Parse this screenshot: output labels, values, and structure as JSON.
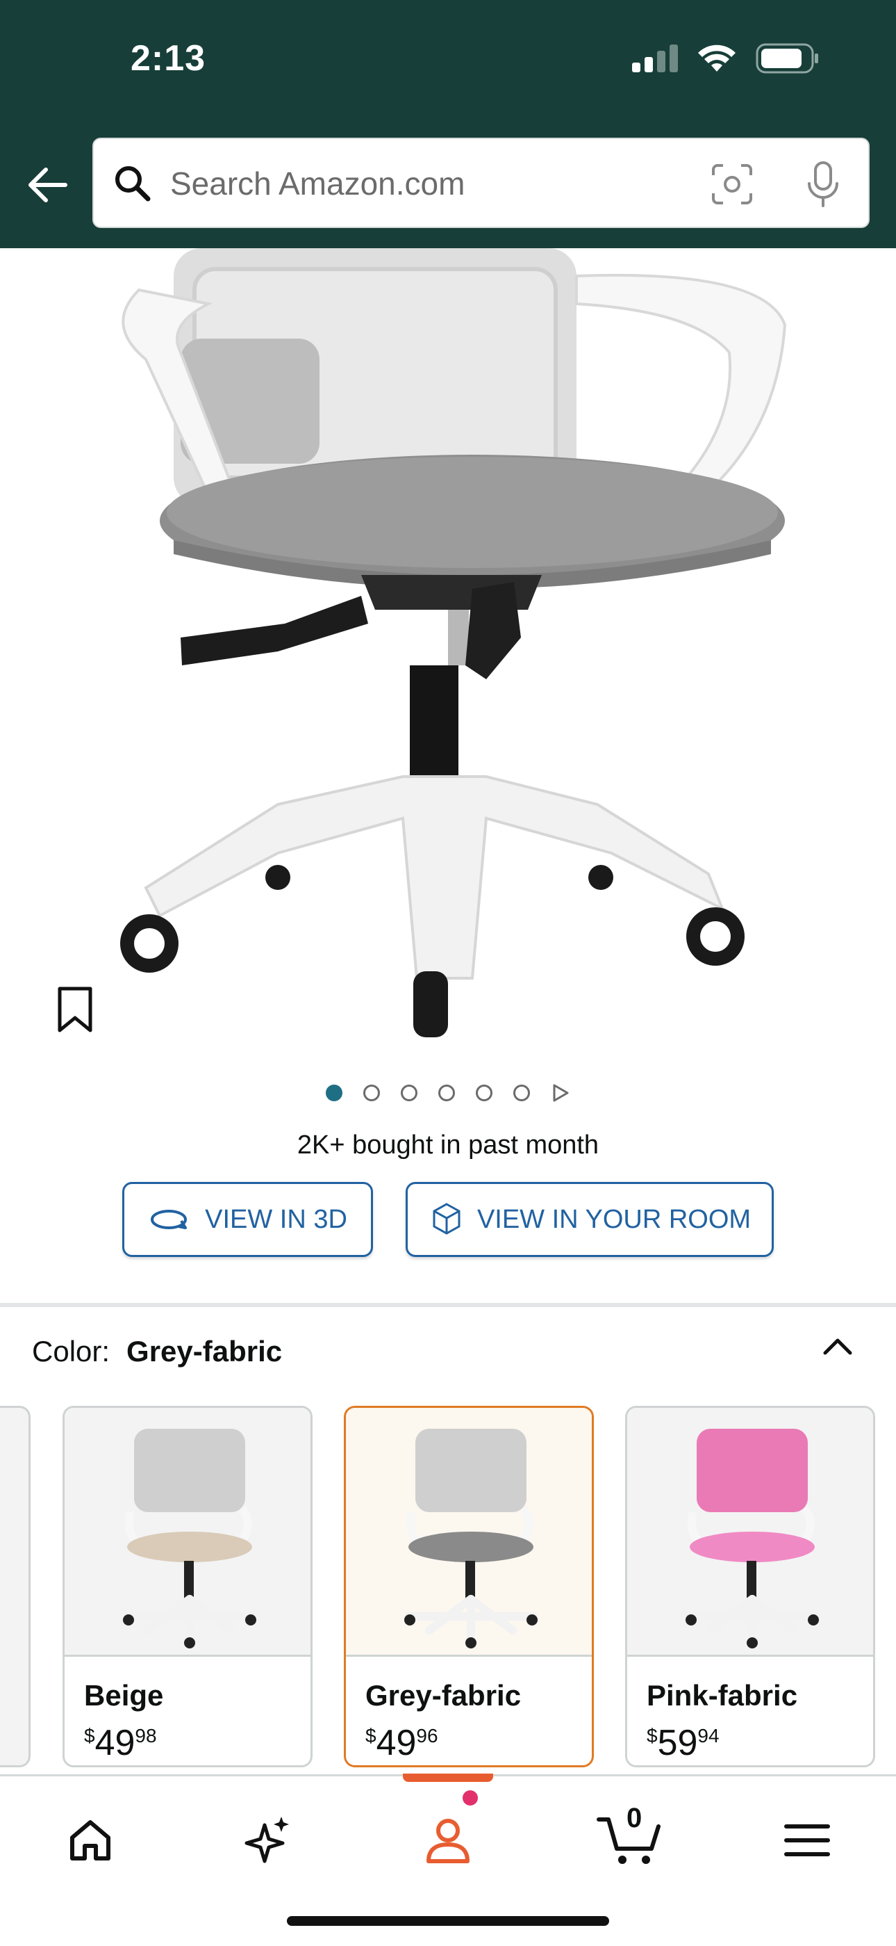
{
  "status_bar": {
    "time": "2:13"
  },
  "search": {
    "placeholder": "Search Amazon.com"
  },
  "product": {
    "image_count": 6,
    "active_image_index": 0,
    "bought_text": "2K+ bought in past month",
    "view_3d_label": "VIEW IN 3D",
    "view_room_label": "VIEW IN YOUR ROOM"
  },
  "color_selector": {
    "label": "Color:",
    "selected": "Grey-fabric",
    "options": [
      {
        "name": "Beige",
        "currency": "$",
        "price_whole": "49",
        "price_fraction": "98",
        "seat_color": "#d9cbb8",
        "back_color": "#d6d6d6"
      },
      {
        "name": "Grey-fabric",
        "currency": "$",
        "price_whole": "49",
        "price_fraction": "96",
        "seat_color": "#8a8a8a",
        "back_color": "#d6d6d6",
        "selected": true
      },
      {
        "name": "Pink-fabric",
        "currency": "$",
        "price_whole": "59",
        "price_fraction": "94",
        "seat_color": "#f08ac4",
        "back_color": "#ea7ab6"
      }
    ]
  },
  "bottom_nav": {
    "items": [
      "home-icon",
      "sparkle-icon",
      "account-icon",
      "cart-icon",
      "menu-icon"
    ],
    "cart_count": "0",
    "active": "account-icon"
  },
  "colors": {
    "header_bg": "#173e38",
    "link_blue": "#2162a1",
    "selected_orange": "#e07b25"
  }
}
